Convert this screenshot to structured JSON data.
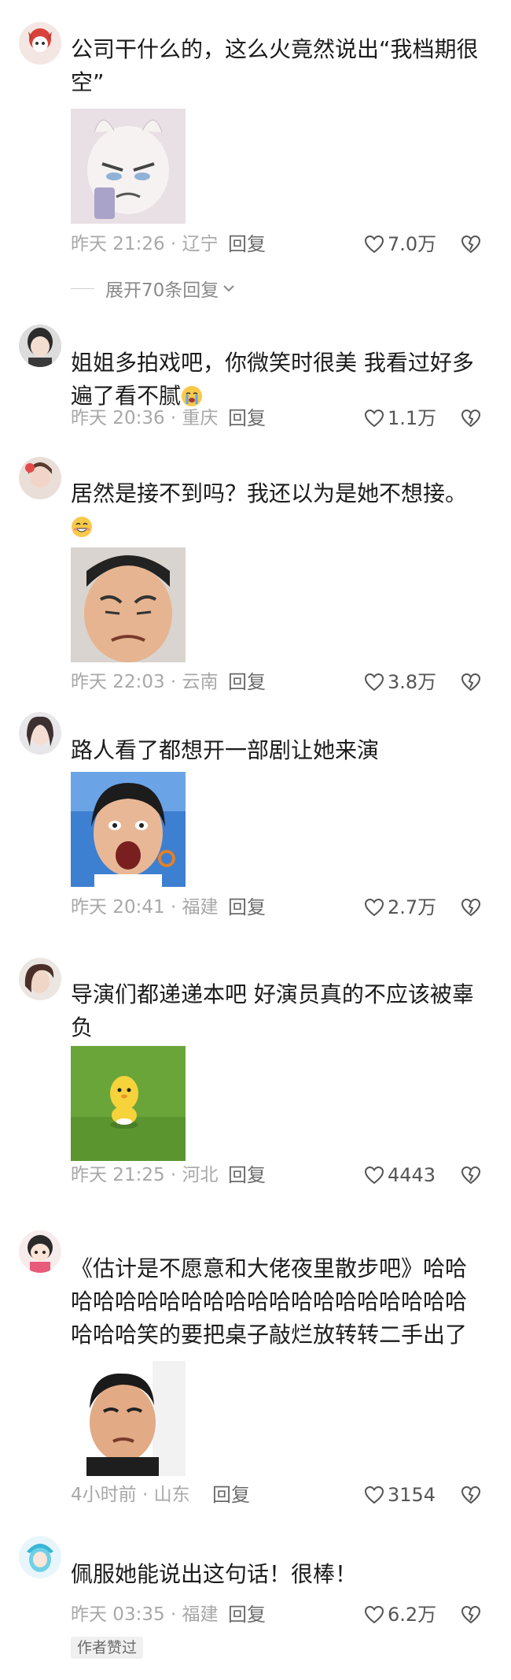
{
  "comments": [
    {
      "text": "公司干什么的，这么火竟然说出“我档期很空”",
      "time_location": "昨天 21:26 · 辽宁",
      "reply": "回复",
      "likes": "7.0万",
      "expand_replies": "展开70条回复"
    },
    {
      "text": "姐姐多拍戏吧，你微笑时很美 我看过好多遍了看不腻",
      "time_location": "昨天 20:36 · 重庆",
      "reply": "回复",
      "likes": "1.1万"
    },
    {
      "text": "居然是接不到吗？我还以为是她不想接。",
      "time_location": "昨天 22:03 · 云南",
      "reply": "回复",
      "likes": "3.8万"
    },
    {
      "text": "路人看了都想开一部剧让她来演",
      "time_location": "昨天 20:41 · 福建",
      "reply": "回复",
      "likes": "2.7万"
    },
    {
      "text": "导演们都递递本吧 好演员真的不应该被辜负",
      "time_location": "昨天 21:25 · 河北",
      "reply": "回复",
      "likes": "4443"
    },
    {
      "text": "《估计是不愿意和大佬夜里散步吧》哈哈哈哈哈哈哈哈哈哈哈哈哈哈哈哈哈哈哈哈哈哈哈笑的要把桌子敲烂放转转二手出了",
      "time_location": "4小时前 · 山东",
      "reply": "回复",
      "likes": "3154"
    },
    {
      "text": "佩服她能说出这句话！很棒！",
      "time_location": "昨天 03:35 · 福建",
      "reply": "回复",
      "likes": "6.2万",
      "badge": "作者赞过"
    }
  ],
  "icons": {
    "like": "heart-outline-icon",
    "dislike": "broken-heart-icon",
    "expand": "chevron-down-icon"
  },
  "colors": {
    "text": "#1c1c1c",
    "meta": "#a8a8a8",
    "reply": "#6a6a6a"
  }
}
